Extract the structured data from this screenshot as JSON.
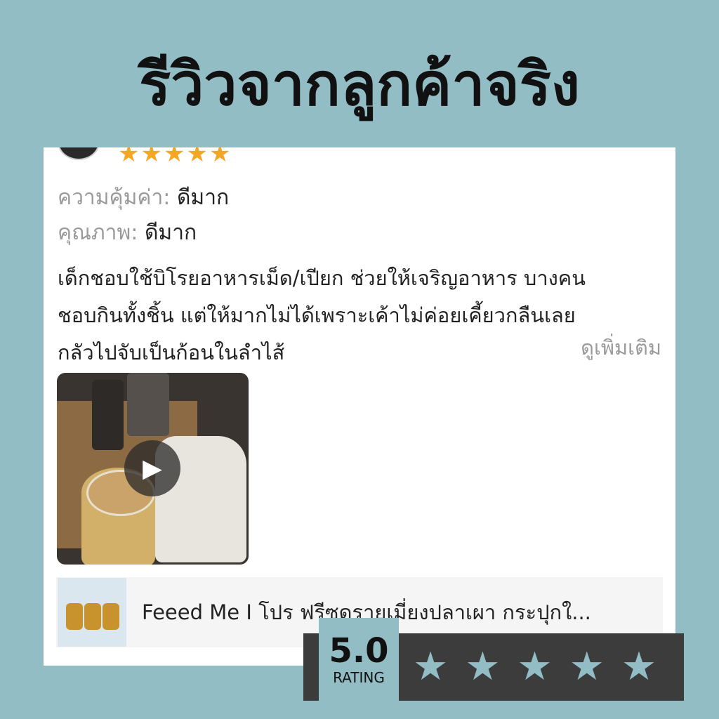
{
  "page_title": "รีวิวจากลูกค้าจริง",
  "review": {
    "stars_small": [
      "★",
      "★",
      "★",
      "★",
      "★"
    ],
    "value_label": "ความคุ้มค่า:",
    "value_value": "ดีมาก",
    "quality_label": "คุณภาพ:",
    "quality_value": "ดีมาก",
    "text_line1": "เด็กชอบใช้บิโรยอาหารเม็ด/เปียก ช่วยให้เจริญอาหาร บางคน",
    "text_line2": "ชอบกินทั้งชิ้น แต่ให้มากไม่ได้เพราะเค้าไม่ค่อยเคี้ยวกลืนเลย",
    "text_line3": "กลัวไปจับเป็นก้อนในลำไส้",
    "see_more": "ดูเพิ่มเติม",
    "play_glyph": "▶"
  },
  "product": {
    "name": "Feeed Me I โปร ฟรีซดรายเมี่ยงปลาเผา กระปุกใ..."
  },
  "rating": {
    "value": "5.0",
    "label": "RATING",
    "stars": [
      "★",
      "★",
      "★",
      "★",
      "★"
    ]
  },
  "colors": {
    "background": "#93bdc5",
    "star_small": "#f5a623",
    "rating_box": "#3c3c3c"
  }
}
